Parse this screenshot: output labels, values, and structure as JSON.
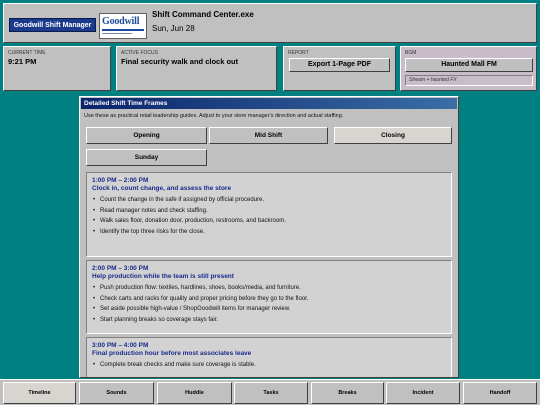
{
  "header": {
    "brand_label": "Goodwill Shift Manager",
    "logo_text": "Goodwill",
    "title": "Shift Command Center.exe",
    "date": "Sun, Jun 28"
  },
  "info": {
    "time_label": "CURRENT TIME",
    "time_value": "9:21 PM",
    "focus_label": "ACTIVE FOCUS",
    "focus_value": "Final security walk and clock out",
    "report_label": "REPORT",
    "export_label": "Export 1-Page PDF",
    "bgm_label": "BGM",
    "bgm_button": "Haunted Mall FM",
    "bgm_status": "Stream + haunted FX"
  },
  "window": {
    "title": "Detailed Shift Time Frames",
    "description": "Use these as practical retail leadership guides. Adjust to your store manager's direction and actual staffing.",
    "tabs": [
      {
        "label": "Opening"
      },
      {
        "label": "Mid Shift"
      },
      {
        "label": "Closing"
      },
      {
        "label": "Sunday"
      }
    ],
    "cards": [
      {
        "time": "1:00 PM – 2:00 PM",
        "heading": "Clock in, count change, and assess the store",
        "items": [
          "Count the change in the safe if assigned by official procedure.",
          "Read manager notes and check staffing.",
          "Walk sales floor, donation door, production, restrooms, and backroom.",
          "Identify the top three risks for the close."
        ]
      },
      {
        "time": "2:00 PM – 3:00 PM",
        "heading": "Help production while the team is still present",
        "items": [
          "Push production flow: textiles, hardlines, shoes, books/media, and furniture.",
          "Check carts and racks for quality and proper pricing before they go to the floor.",
          "Set aside possible high-value / ShopGoodwill items for manager review.",
          "Start planning breaks so coverage stays fair."
        ]
      },
      {
        "time": "3:00 PM – 4:00 PM",
        "heading": "Final production hour before most associates leave",
        "items": [
          "Complete break checks and make sure coverage is stable."
        ]
      }
    ]
  },
  "nav": [
    {
      "label": "Timeline"
    },
    {
      "label": "Sounds"
    },
    {
      "label": "Huddle"
    },
    {
      "label": "Tasks"
    },
    {
      "label": "Breaks"
    },
    {
      "label": "Incident"
    },
    {
      "label": "Handoff"
    }
  ],
  "colors": {
    "desktop": "#008080",
    "panel": "#c0c0c0",
    "title_bar": "#0a246a",
    "accent_text": "#1a2a8c"
  }
}
